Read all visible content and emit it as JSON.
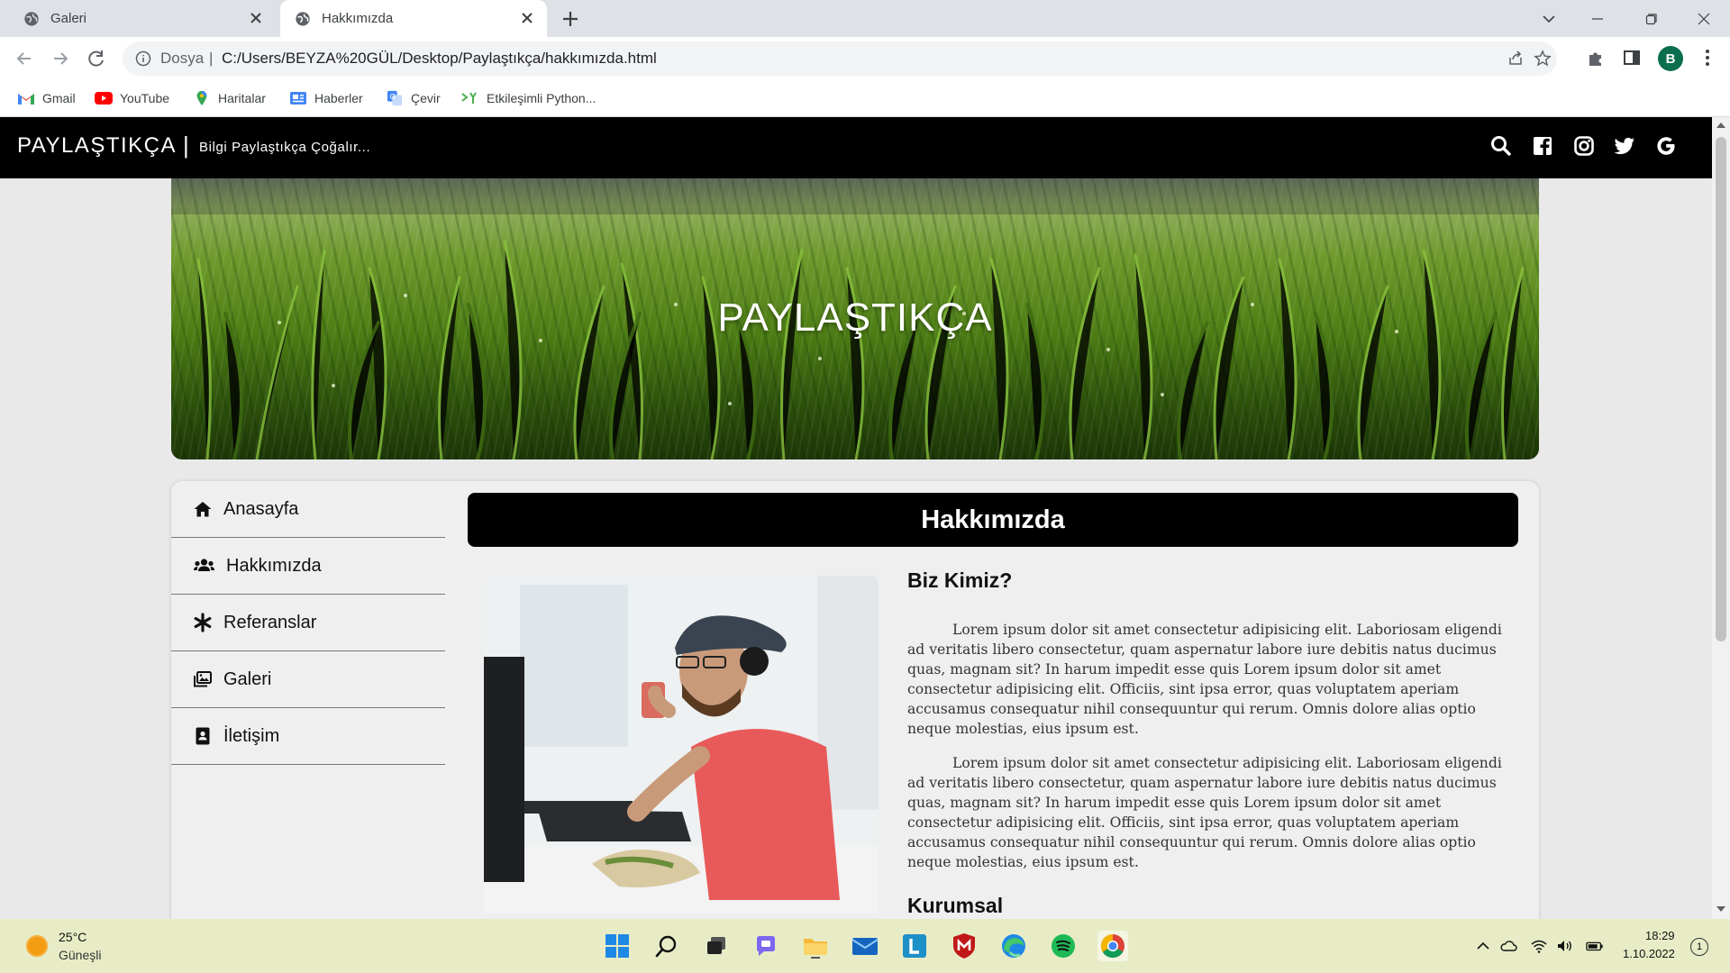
{
  "browser": {
    "tabs": [
      {
        "label": "Galeri",
        "active": false
      },
      {
        "label": "Hakkımızda",
        "active": true
      }
    ],
    "omnibox": {
      "scheme_label": "Dosya",
      "separator": "|",
      "url": "C:/Users/BEYZA%20GÜL/Desktop/Paylaştıkça/hakkımızda.html"
    },
    "profile_initial": "B",
    "bookmarks": [
      {
        "label": "Gmail",
        "icon": "gmail-icon"
      },
      {
        "label": "YouTube",
        "icon": "youtube-icon"
      },
      {
        "label": "Haritalar",
        "icon": "maps-icon"
      },
      {
        "label": "Haberler",
        "icon": "news-icon"
      },
      {
        "label": "Çevir",
        "icon": "translate-icon"
      },
      {
        "label": "Etkileşimli Python...",
        "icon": "python-icon"
      }
    ]
  },
  "site": {
    "brand": "PAYLAŞTIKÇA",
    "divider": "|",
    "tagline": "Bilgi Paylaştıkça Çoğalır...",
    "social_icons": [
      "search-icon",
      "facebook-icon",
      "instagram-icon",
      "twitter-icon",
      "google-icon"
    ],
    "hero_title": "PAYLAŞTIKÇA",
    "nav": [
      {
        "label": "Anasayfa",
        "icon": "home-icon"
      },
      {
        "label": "Hakkımızda",
        "icon": "users-icon"
      },
      {
        "label": "Referanslar",
        "icon": "asterisk-icon"
      },
      {
        "label": "Galeri",
        "icon": "images-icon"
      },
      {
        "label": "İletişim",
        "icon": "contact-book-icon"
      }
    ],
    "section_title": "Hakkımızda",
    "subheading_1": "Biz Kimiz?",
    "paragraph_1": "Lorem ipsum dolor sit amet consectetur adipisicing elit. Laboriosam eligendi ad veritatis libero consectetur, quam aspernatur labore iure debitis natus ducimus quas, magnam sit? In harum impedit esse quis Lorem ipsum dolor sit amet consectetur adipisicing elit. Officiis, sint ipsa error, quas voluptatem aperiam accusamus consequatur nihil consequuntur qui rerum. Omnis dolore alias optio neque molestias, eius ipsum est.",
    "paragraph_2": "Lorem ipsum dolor sit amet consectetur adipisicing elit. Laboriosam eligendi ad veritatis libero consectetur, quam aspernatur labore iure debitis natus ducimus quas, magnam sit? In harum impedit esse quis Lorem ipsum dolor sit amet consectetur adipisicing elit. Officiis, sint ipsa error, quas voluptatem aperiam accusamus consequatur nihil consequuntur qui rerum. Omnis dolore alias optio neque molestias, eius ipsum est.",
    "subheading_2": "Kurumsal"
  },
  "taskbar": {
    "weather_temp": "25°C",
    "weather_desc": "Güneşli",
    "time": "18:29",
    "date": "1.10.2022",
    "notification_count": "1"
  },
  "colors": {
    "site_header": "#000000",
    "page_background": "#e9e9e9",
    "taskbar": "#e8ecc6",
    "tabstrip": "#dee1e6"
  }
}
